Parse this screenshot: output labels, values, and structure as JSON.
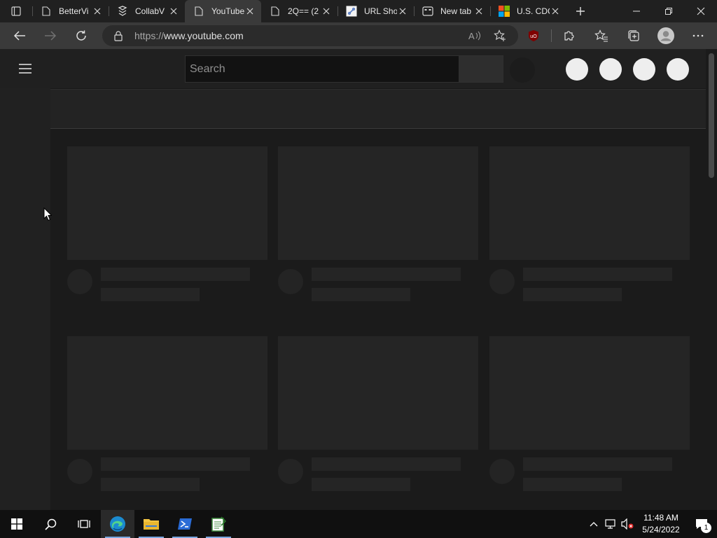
{
  "browser": {
    "tabs": [
      {
        "title": "BetterVi",
        "icon": "page-icon",
        "active": false
      },
      {
        "title": "CollabV",
        "icon": "collab-icon",
        "active": false
      },
      {
        "title": "YouTube",
        "icon": "page-icon",
        "active": true
      },
      {
        "title": "2Q== (2",
        "icon": "page-icon",
        "active": false
      },
      {
        "title": "URL Sho",
        "icon": "url-shortener-icon",
        "active": false
      },
      {
        "title": "New tab",
        "icon": "newtab-icon",
        "active": false
      },
      {
        "title": "U.S. CDC",
        "icon": "microsoft-icon",
        "active": false
      }
    ],
    "address": {
      "protocol": "https://",
      "host": "www.youtube.com"
    }
  },
  "youtube": {
    "search_placeholder": "Search",
    "header_circles": 4,
    "video_skeleton_rows": 2,
    "video_skeleton_cols": 3
  },
  "taskbar": {
    "apps": [
      "start-icon",
      "search-icon",
      "task-view-icon",
      "edge-icon",
      "file-explorer-icon",
      "powershell-icon",
      "notepad-icon"
    ],
    "time": "11:48 AM",
    "date": "5/24/2022",
    "notification_count": "1"
  },
  "colors": {
    "page_bg": "#181818",
    "header_bg": "#202020",
    "skeleton": "#252525",
    "accent": "#7aa7e0"
  }
}
